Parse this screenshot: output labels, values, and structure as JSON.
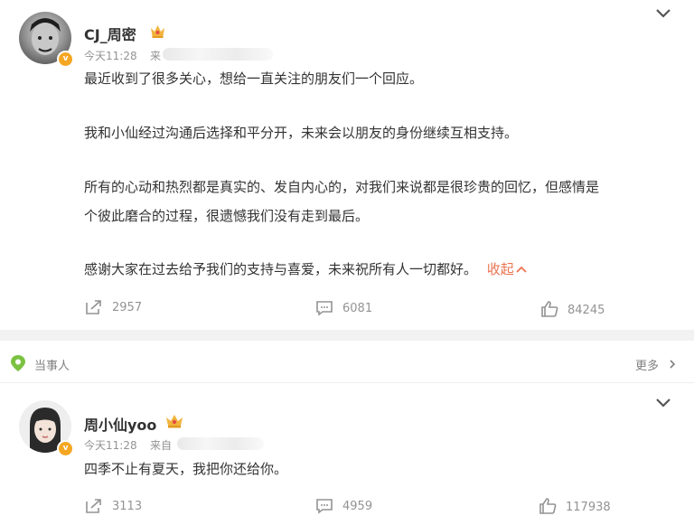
{
  "post1": {
    "username": "CJ_周密",
    "time": "今天11:28",
    "source_prefix": "来",
    "paragraphs": [
      "最近收到了很多关心，想给一直关注的朋友们一个回应。",
      "我和小仙经过沟通后选择和平分开，未来会以朋友的身份继续互相支持。",
      "所有的心动和热烈都是真实的、发自内心的，对我们来说都是很珍贵的回忆，但感情是",
      "个彼此磨合的过程，很遗憾我们没有走到最后。",
      "感谢大家在过去给予我们的支持与喜爱，未来祝所有人一切都好。"
    ],
    "collapse_label": "收起",
    "repost_count": "2957",
    "comment_count": "6081",
    "like_count": "84245"
  },
  "section": {
    "label": "当事人",
    "more_label": "更多"
  },
  "post2": {
    "username": "周小仙yoo",
    "time": "今天11:28",
    "source_prefix": "来自",
    "text": "四季不止有夏天，我把你还给你。",
    "repost_count": "3113",
    "comment_count": "4959",
    "like_count": "117938"
  },
  "colors": {
    "accent": "#eb7350",
    "verified": "#f5a623",
    "crown": "#f2b33d",
    "pin_green": "#7cc242",
    "muted": "#939393"
  },
  "icons": [
    "chevron-down-icon",
    "crown-icon",
    "verified-icon",
    "repost-icon",
    "comment-icon",
    "like-icon",
    "location-pin-icon",
    "chevron-right-icon",
    "chevron-up-icon"
  ]
}
